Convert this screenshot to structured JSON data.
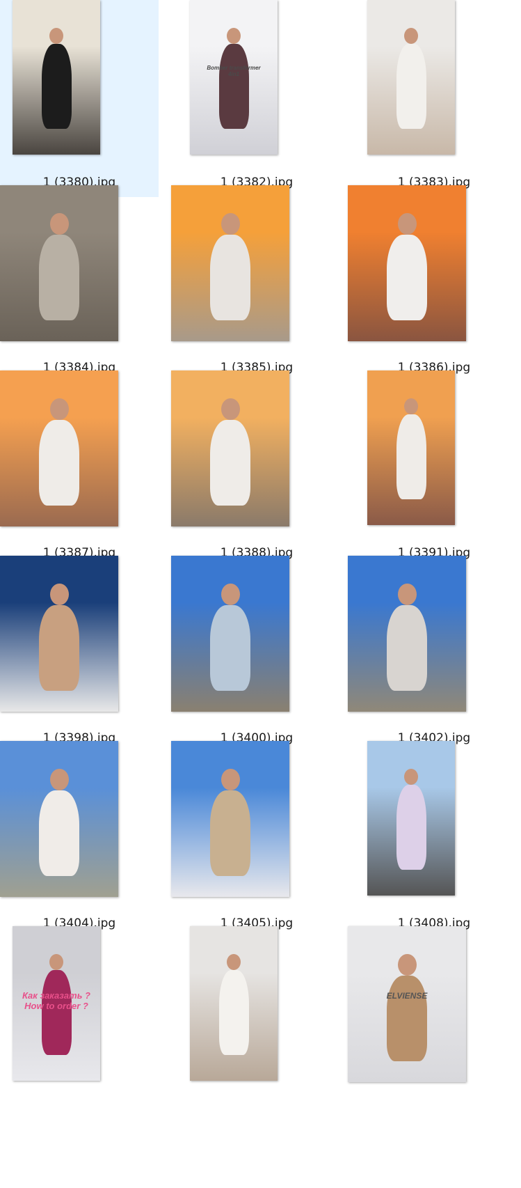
{
  "files": [
    {
      "name": "1 (3380).jpg",
      "selected": true,
      "variant": "portrait",
      "bg": [
        "#e8e2d6",
        "#4a4540"
      ],
      "accent": "#1c1c1c",
      "figure": true
    },
    {
      "name": "1 (3382).jpg",
      "selected": false,
      "variant": "portrait",
      "bg": [
        "#f3f3f5",
        "#d0d0d6"
      ],
      "accent": "#5a3a40",
      "figure": true,
      "overlay": {
        "lines": [
          "Bomber transformer",
          "4in1"
        ],
        "color": "#4a4a4a",
        "size": 8
      }
    },
    {
      "name": "1 (3383).jpg",
      "selected": false,
      "variant": "portrait",
      "bg": [
        "#ebe9e6",
        "#c8b8a8"
      ],
      "accent": "#f2f0ec",
      "figure": true
    },
    {
      "name": "1 (3384).jpg",
      "selected": false,
      "variant": "landscape-tall",
      "bg": [
        "#8f867a",
        "#6a6258"
      ],
      "accent": "#b8b0a4",
      "figure": true
    },
    {
      "name": "1 (3385).jpg",
      "selected": false,
      "variant": "landscape-tall",
      "bg": [
        "#f5a03a",
        "#a89a8a"
      ],
      "accent": "#e8e4e0",
      "figure": true
    },
    {
      "name": "1 (3386).jpg",
      "selected": false,
      "variant": "landscape-tall",
      "bg": [
        "#f08030",
        "#8a5540"
      ],
      "accent": "#f0eeec",
      "figure": true
    },
    {
      "name": "1 (3387).jpg",
      "selected": false,
      "variant": "landscape-tall",
      "bg": [
        "#f5a050",
        "#9a6a50"
      ],
      "accent": "#efece8",
      "figure": true
    },
    {
      "name": "1 (3388).jpg",
      "selected": false,
      "variant": "landscape-tall",
      "bg": [
        "#f2b060",
        "#8a7a6a"
      ],
      "accent": "#efece8",
      "figure": true
    },
    {
      "name": "1 (3391).jpg",
      "selected": false,
      "variant": "portrait",
      "bg": [
        "#f0a050",
        "#8a5a48"
      ],
      "accent": "#efece8",
      "figure": true
    },
    {
      "name": "1 (3398).jpg",
      "selected": false,
      "variant": "landscape-tall",
      "bg": [
        "#1a3f7a",
        "#e8e8e8"
      ],
      "accent": "#c8a080",
      "figure": true
    },
    {
      "name": "1 (3400).jpg",
      "selected": false,
      "variant": "landscape-tall",
      "bg": [
        "#3a78d0",
        "#8a8070"
      ],
      "accent": "#b8c8d8",
      "figure": true
    },
    {
      "name": "1 (3402).jpg",
      "selected": false,
      "variant": "landscape-tall",
      "bg": [
        "#3a78d0",
        "#908878"
      ],
      "accent": "#d8d4d0",
      "figure": true
    },
    {
      "name": "1 (3404).jpg",
      "selected": false,
      "variant": "landscape-tall",
      "bg": [
        "#5a90d8",
        "#a0a090"
      ],
      "accent": "#f0ece8",
      "figure": true
    },
    {
      "name": "1 (3405).jpg",
      "selected": false,
      "variant": "landscape-tall",
      "bg": [
        "#4a88d8",
        "#e8e8ec"
      ],
      "accent": "#c8b090",
      "figure": true
    },
    {
      "name": "1 (3408).jpg",
      "selected": false,
      "variant": "portrait",
      "bg": [
        "#a8c8e8",
        "#555555"
      ],
      "accent": "#ddd0e8",
      "figure": true
    },
    {
      "name": "",
      "selected": false,
      "variant": "portrait",
      "bg": [
        "#cfcfd4",
        "#e8e8ec"
      ],
      "accent": "#a0285a",
      "figure": true,
      "overlay": {
        "lines": [
          "Как заказать ?",
          "How to order ?"
        ],
        "color": "#e8508a",
        "size": 13
      }
    },
    {
      "name": "",
      "selected": false,
      "variant": "portrait",
      "bg": [
        "#e6e4e2",
        "#b8a898"
      ],
      "accent": "#f4f2ee",
      "figure": true
    },
    {
      "name": "",
      "selected": false,
      "variant": "landscape-tall",
      "bg": [
        "#e8e8ea",
        "#d8d8dc"
      ],
      "accent": "#b8906a",
      "figure": true,
      "overlay": {
        "lines": [
          "ELVIENSE"
        ],
        "color": "#555555",
        "size": 12
      }
    }
  ]
}
